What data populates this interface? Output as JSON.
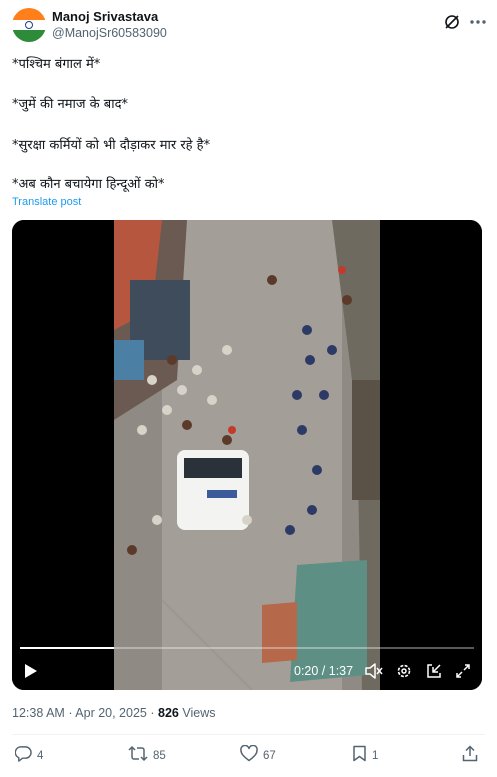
{
  "author": {
    "name": "Manoj Srivastava",
    "handle": "@ManojSr60583090"
  },
  "tweet": {
    "lines": [
      "*पश्चिम बंगाल में*",
      "*जुमें की नमाज के बाद*",
      "*सुरक्षा कर्मियों को भी दौड़ाकर मार रहे है*",
      "*अब कौन बचायेगा हिन्दूओं को*"
    ],
    "translate_label": "Translate post"
  },
  "video": {
    "time_label": "0:20 / 1:37",
    "progress": 0.206
  },
  "meta": {
    "time": "12:38 AM",
    "separator": "·",
    "date": "Apr 20, 2025",
    "views_count": "826",
    "views_label": "Views"
  },
  "actions": {
    "replies": "4",
    "reposts": "85",
    "likes": "67",
    "bookmarks": "1"
  },
  "colors": {
    "link": "#1d9bf0",
    "secondary_text": "#536471",
    "primary_text": "#0f1419"
  },
  "icons": {
    "grok": "grok-icon",
    "more": "more-icon",
    "play": "play-icon",
    "volume": "volume-icon",
    "settings": "settings-icon",
    "pip": "picture-in-picture-icon",
    "fullscreen": "fullscreen-icon",
    "reply": "reply-icon",
    "repost": "repost-icon",
    "like": "like-icon",
    "bookmark": "bookmark-icon",
    "share": "share-icon"
  }
}
